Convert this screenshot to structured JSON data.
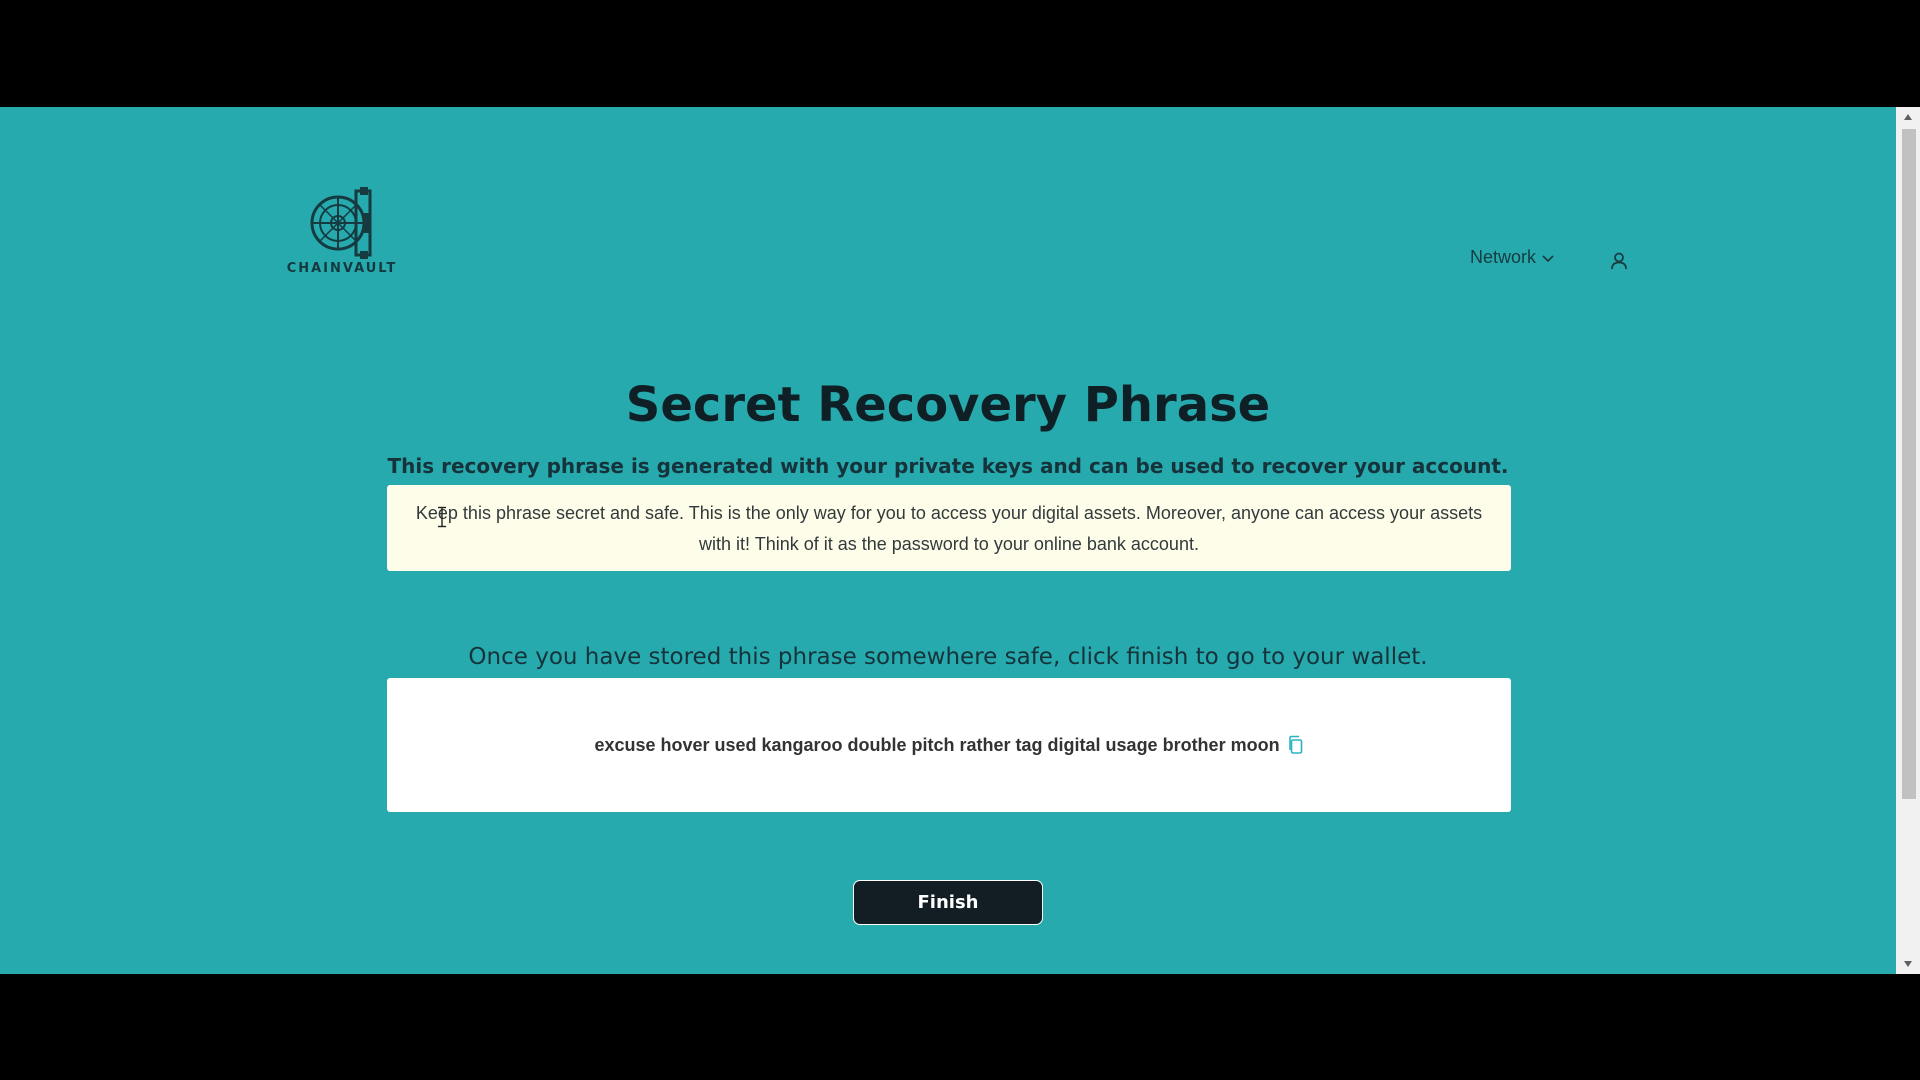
{
  "header": {
    "logo_text": "CHAINVAULT",
    "network_label": "Network",
    "network_chevron": "chevron-down-icon",
    "user_icon": "user-icon"
  },
  "main": {
    "title": "Secret Recovery Phrase",
    "subtitle": "This recovery phrase is generated with your private keys and can be used to recover your account.",
    "warning": "Keep this phrase secret and safe. This is the only way for you to access your digital assets. Moreover, anyone can access your assets with it! Think of it as the password to your online bank account.",
    "instruction": "Once you have stored this phrase somewhere safe, click finish to go to your wallet.",
    "phrase": "excuse hover used kangaroo double pitch rather tag digital usage brother moon",
    "copy_icon": "copy-icon",
    "finish_label": "Finish"
  },
  "colors": {
    "background": "#26aaad",
    "warning_bg": "#fdfde9",
    "button_bg": "#131d24",
    "copy_icon": "#2bb3c5"
  }
}
